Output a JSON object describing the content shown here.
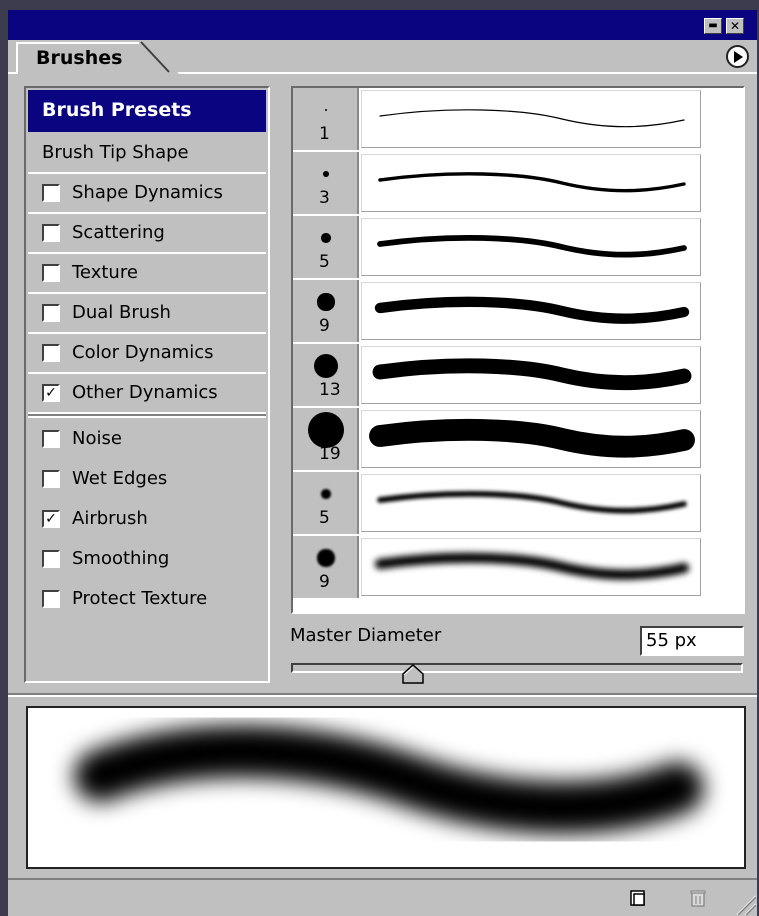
{
  "panel": {
    "tab_label": "Brushes",
    "window_buttons": {
      "minimize_glyph": "▬",
      "close_glyph": "✕"
    }
  },
  "options": {
    "header": "Brush Presets",
    "tip_shape": "Brush Tip Shape",
    "items": [
      {
        "label": "Shape Dynamics",
        "checked": false
      },
      {
        "label": "Scattering",
        "checked": false
      },
      {
        "label": "Texture",
        "checked": false
      },
      {
        "label": "Dual Brush",
        "checked": false
      },
      {
        "label": "Color Dynamics",
        "checked": false
      },
      {
        "label": "Other Dynamics",
        "checked": true
      }
    ],
    "extras": [
      {
        "label": "Noise",
        "checked": false
      },
      {
        "label": "Wet Edges",
        "checked": false
      },
      {
        "label": "Airbrush",
        "checked": true
      },
      {
        "label": "Smoothing",
        "checked": false
      },
      {
        "label": "Protect Texture",
        "checked": false
      }
    ]
  },
  "presets": [
    {
      "size": "1",
      "hardness": "hard"
    },
    {
      "size": "3",
      "hardness": "hard"
    },
    {
      "size": "5",
      "hardness": "hard"
    },
    {
      "size": "9",
      "hardness": "hard"
    },
    {
      "size": "13",
      "hardness": "hard"
    },
    {
      "size": "19",
      "hardness": "hard"
    },
    {
      "size": "5",
      "hardness": "soft"
    },
    {
      "size": "9",
      "hardness": "soft"
    }
  ],
  "master_diameter": {
    "label": "Master Diameter",
    "value": "55 px",
    "slider_fraction": 0.27
  },
  "icons": {
    "menu": "circle-arrow-right-icon",
    "new_preset": "new-preset-icon",
    "delete": "trash-icon",
    "grip": "resize-grip-icon"
  },
  "colors": {
    "title_bar": "#0b0480",
    "selected_header": "#0b0480",
    "panel_bg": "#c0c0c0"
  }
}
